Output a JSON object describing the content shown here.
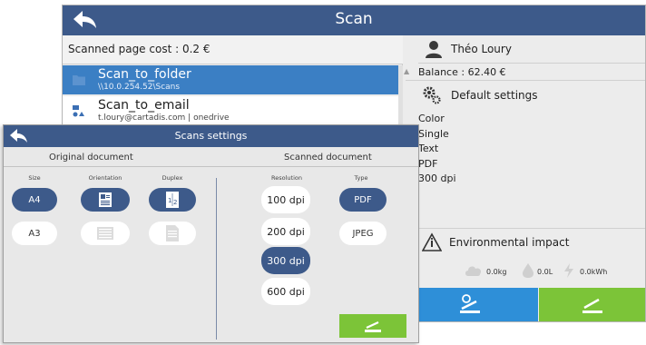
{
  "scan_window": {
    "title": "Scan",
    "scanned_page_cost": "Scanned page cost : 0.2 €",
    "destinations": [
      {
        "name": "Scan_to_folder",
        "path": "\\\\10.0.254.52\\Scans",
        "selected": true
      },
      {
        "name": "Scan_to_email",
        "path": "t.loury@cartadis.com | onedrive",
        "selected": false
      }
    ],
    "user_name": "Théo Loury",
    "balance": "Balance : 62.40 €",
    "default_settings_label": "Default settings",
    "defaults": [
      "Color",
      "Single",
      "Text",
      "PDF",
      "300 dpi"
    ],
    "environmental_impact_label": "Environmental impact",
    "metrics": {
      "co2": "0.0kg",
      "water": "0.0L",
      "energy": "0.0kWh"
    }
  },
  "settings_window": {
    "title": "Scans settings",
    "original_document": "Original document",
    "scanned_document": "Scanned document",
    "columns": {
      "size": "Size",
      "orientation": "Orientation",
      "duplex": "Duplex",
      "resolution": "Resolution",
      "type": "Type"
    },
    "sizes": [
      {
        "label": "A4",
        "selected": true
      },
      {
        "label": "A3",
        "selected": false
      }
    ],
    "resolutions": [
      {
        "label": "100 dpi",
        "selected": false
      },
      {
        "label": "200 dpi",
        "selected": false
      },
      {
        "label": "300 dpi",
        "selected": true
      },
      {
        "label": "600 dpi",
        "selected": false
      }
    ],
    "types": [
      {
        "label": "PDF",
        "selected": true
      },
      {
        "label": "JPEG",
        "selected": false
      }
    ]
  },
  "colors": {
    "header": "#3d5a8a",
    "selection": "#3b7fc4",
    "blue_action": "#2e8fd8",
    "green_action": "#7cc438"
  }
}
